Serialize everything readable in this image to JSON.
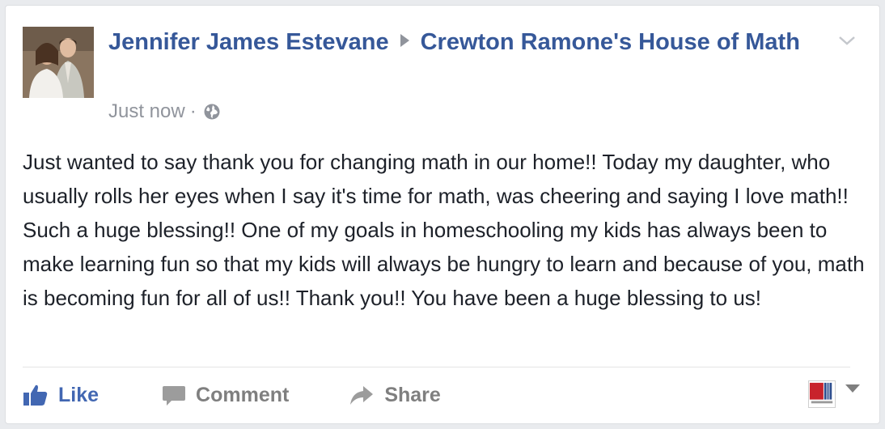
{
  "post": {
    "author": "Jennifer James Estevane",
    "target_page": "Crewton Ramone's House of Math",
    "timestamp": "Just now",
    "separator": "·",
    "privacy_icon": "globe-icon",
    "menu_icon": "chevron-down-icon",
    "text": "Just wanted to say thank you for changing math in our home!! Today my daughter, who usually rolls her eyes when I say it's time for math, was cheering and saying I love math!! Such a huge blessing!! One of my goals in homeschooling my kids has always been to make learning fun so that my kids will always be hungry to learn and because of you, math is becoming fun for all of us!! Thank you!! You have been a huge blessing to us!"
  },
  "actions": {
    "like_label": "Like",
    "comment_label": "Comment",
    "share_label": "Share"
  },
  "colors": {
    "link_blue": "#365899",
    "like_blue": "#4267b2",
    "action_gray": "#7f7f7f",
    "meta_gray": "#90949c",
    "text": "#1d2129"
  }
}
